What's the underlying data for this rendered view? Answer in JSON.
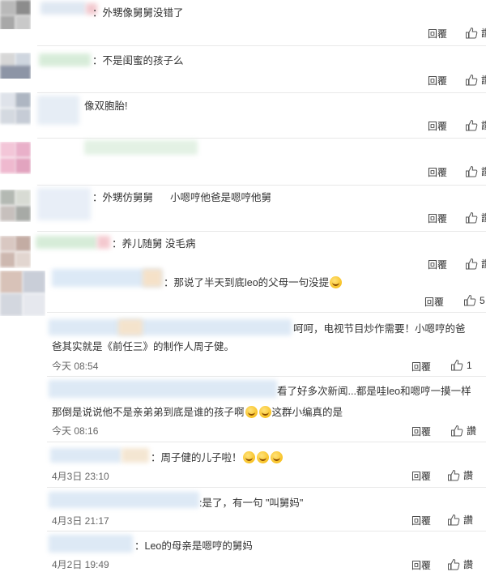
{
  "comments": [
    {
      "text": "：外甥像舅舅没错了",
      "reply": "回覆",
      "like": "讚"
    },
    {
      "text": "：不是闺蜜的孩子么",
      "reply": "回覆",
      "like": "讚"
    },
    {
      "text": "像双胞胎!",
      "reply": "回覆",
      "like": "讚"
    },
    {
      "text": "",
      "reply": "回覆",
      "like": "讚"
    },
    {
      "text": "：外甥仿舅舅",
      "text2": "小嗯哼他爸是嗯哼他舅",
      "reply": "回覆",
      "like": "讚"
    },
    {
      "text": "：养儿随舅 没毛病",
      "reply": "回覆",
      "like": "讚"
    }
  ],
  "replies": [
    {
      "text": "：那说了半天到底leo的父母一句没提",
      "reply": "回覆",
      "like": "5"
    },
    {
      "text": "呵呵，电视节目炒作需要！小嗯哼的爸",
      "text_line2": "爸其实就是《前任三》的制作人周子健。",
      "time": "今天 08:54",
      "reply": "回覆",
      "like": "1"
    },
    {
      "text": "看了好多次新闻...都是哇leo和嗯哼一摸一样",
      "text_line2": "那倒是说说他不是亲弟弟到底是谁的孩子啊",
      "text_line2_end": "这群小编真的是",
      "time": "今天 08:16",
      "reply": "回覆",
      "like": "讚"
    },
    {
      "text": "：周子健的儿子啦！",
      "time": "4月3日 23:10",
      "reply": "回覆",
      "like": "讚"
    },
    {
      "text": ":是了，有一句 \"叫舅妈\"",
      "time": "4月3日 21:17",
      "reply": "回覆",
      "like": "讚"
    },
    {
      "text": "：Leo的母亲是嗯哼的舅妈",
      "time": "4月2日 19:49",
      "reply": "回覆",
      "like": "讚"
    }
  ]
}
